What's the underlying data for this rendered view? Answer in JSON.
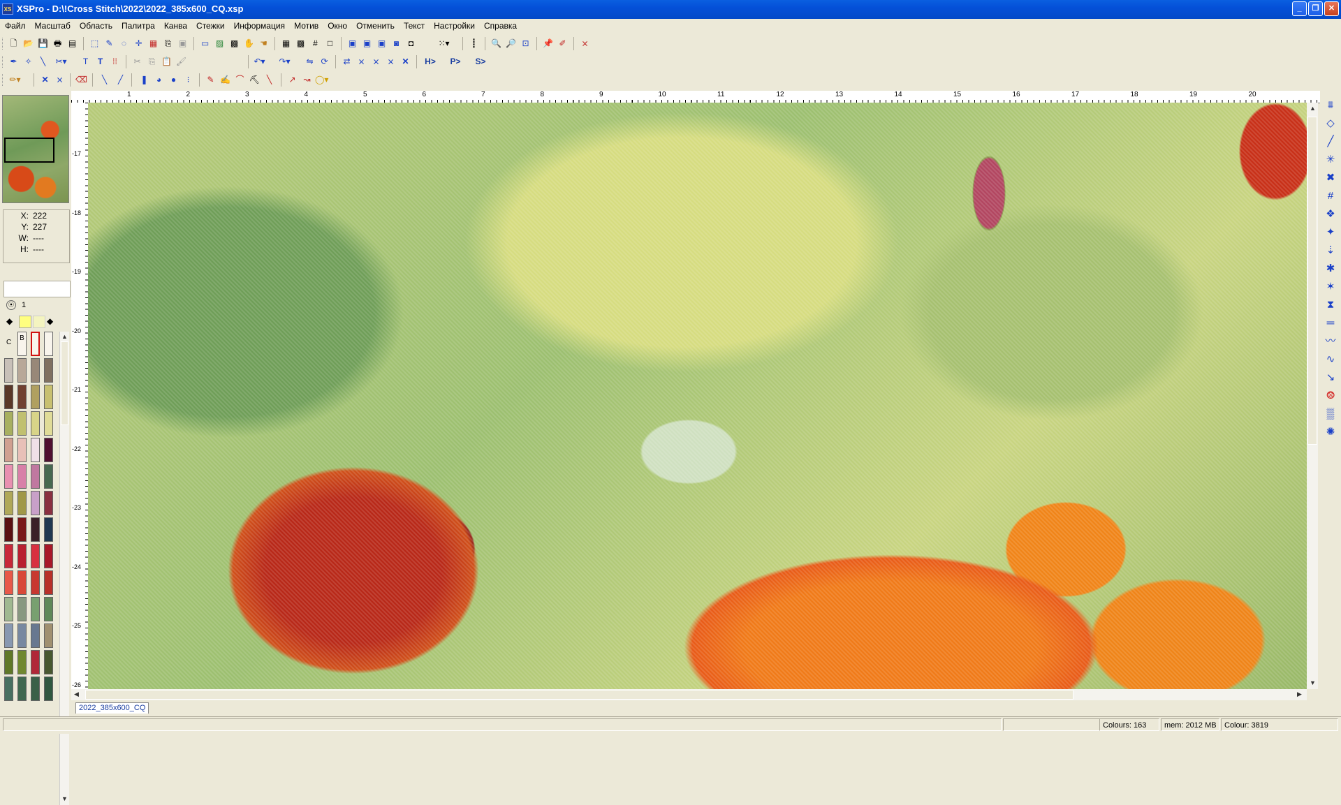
{
  "window": {
    "icon_label": "XS",
    "title": "XSPro - D:\\!Cross Stitch\\2022\\2022_385x600_CQ.xsp",
    "minimize": "_",
    "maximize": "❐",
    "close": "✕"
  },
  "menu": [
    "Файл",
    "Масштаб",
    "Область",
    "Палитра",
    "Канва",
    "Стежки",
    "Информация",
    "Мотив",
    "Окно",
    "Отменить",
    "Текст",
    "Настройки",
    "Справка"
  ],
  "toolbar": {
    "row1": [
      "new-icon",
      "open-icon",
      "save-icon",
      "print-icon",
      "preview-icon",
      "select-rect-icon",
      "select-color-icon",
      "lasso-icon",
      "crosshair-icon",
      "fill-select-icon",
      "copy-area-icon",
      "paste-area-icon",
      "monitor-icon",
      "image-icon",
      "picture-icon",
      "hand-icon",
      "hand-move-icon",
      "grid-icon",
      "grid-fine-icon",
      "grid-lines-icon",
      "blank-icon",
      "view1-icon",
      "view2-icon",
      "view3-icon",
      "view4-icon",
      "view5-icon",
      "grid-select-icon",
      "ruler-icon",
      "zoom-in-icon",
      "zoom-out-icon",
      "zoom-fit-icon",
      "pin-icon",
      "pin-red-icon",
      "crossout-icon"
    ],
    "row2": [
      "pen-icon",
      "wand-icon",
      "needle-icon",
      "scissors-icon",
      "text-t-icon",
      "text-t2-icon",
      "dots-icon",
      "cut-icon",
      "copy-icon",
      "paste-icon",
      "brush-icon",
      "undo-icon",
      "redo-icon",
      "flip-icon",
      "rotate-icon",
      "mirror-icon",
      "cross1-icon",
      "cross2-icon",
      "cross3-icon",
      "cross4-icon",
      "cross5-icon",
      "cross6-icon",
      "h-button",
      "p-button",
      "s-button"
    ],
    "row3": [
      "pencil-icon",
      "cross-stitch-icon",
      "double-cross-icon",
      "eraser-icon",
      "backstitch-icon",
      "line-icon",
      "bead-icon",
      "french-knot-icon",
      "circle-icon",
      "stroke-icon",
      "pen-line-icon",
      "pen-curve-icon",
      "stamp-icon",
      "needle-brush-icon",
      "arc1-icon",
      "arc2-icon",
      "ellipse-icon"
    ],
    "row2_labels": [
      "H>",
      "P>",
      "S>"
    ]
  },
  "coords": {
    "x_label": "X:",
    "x_value": "222",
    "y_label": "Y:",
    "y_value": "227",
    "w_label": "W:",
    "w_value": "----",
    "h_label": "H:",
    "h_value": "----"
  },
  "layer": {
    "number": "1"
  },
  "palette_header": {
    "c_label": "C",
    "b_label": "B"
  },
  "palette_colors": [
    "#c8c0b8",
    "#b8a898",
    "#988878",
    "#807060",
    "#5a3828",
    "#704030",
    "#b0a060",
    "#c8c070",
    "#a8b060",
    "#c0c070",
    "#d8d488",
    "#e0dc98",
    "#d0a090",
    "#e8c0b8",
    "#f0e0e8",
    "#501030",
    "#e890b0",
    "#d880a8",
    "#c078a0",
    "#486850",
    "#b0a858",
    "#a09848",
    "#c8a0c8",
    "#8a3040",
    "#5a1010",
    "#7a1818",
    "#3a2028",
    "#203850",
    "#c82838",
    "#b82030",
    "#d83040",
    "#a81828",
    "#e85848",
    "#d84838",
    "#c83830",
    "#b83028",
    "#a0b890",
    "#889880",
    "#78a070",
    "#608858",
    "#8898b0",
    "#7888a0",
    "#687890",
    "#a09070",
    "#607828",
    "#708830",
    "#b02838",
    "#485830",
    "#487060",
    "#406850",
    "#3a6048",
    "#305840"
  ],
  "hruler_labels": [
    "1",
    "2",
    "3",
    "4",
    "5",
    "6",
    "7",
    "8",
    "9",
    "10",
    "11",
    "12",
    "13",
    "14",
    "15",
    "16",
    "17",
    "18",
    "19",
    "20"
  ],
  "vruler_labels": [
    "-17",
    "-18",
    "-19",
    "-20",
    "-21",
    "-22",
    "-23",
    "-24",
    "-25",
    "-26"
  ],
  "right_tools": [
    "stitch-full-icon",
    "stitch-half-icon",
    "stitch-quarter-icon",
    "star-icon",
    "cross-fill-icon",
    "grid-hash-icon",
    "diamond-icon",
    "star4-icon",
    "arrow-down-icon",
    "x-star-icon",
    "sparkle-icon",
    "hourglass-icon",
    "stripe-icon",
    "wave-icon",
    "wave2-icon",
    "arrow-diag-icon",
    "x-red-icon",
    "hatch-icon",
    "starburst-icon"
  ],
  "tab": {
    "label": "2022_385x600_CQ"
  },
  "status": {
    "colours": "Colours: 163",
    "mem": "mem: 2012 MB",
    "colour": "Colour: 3819"
  }
}
